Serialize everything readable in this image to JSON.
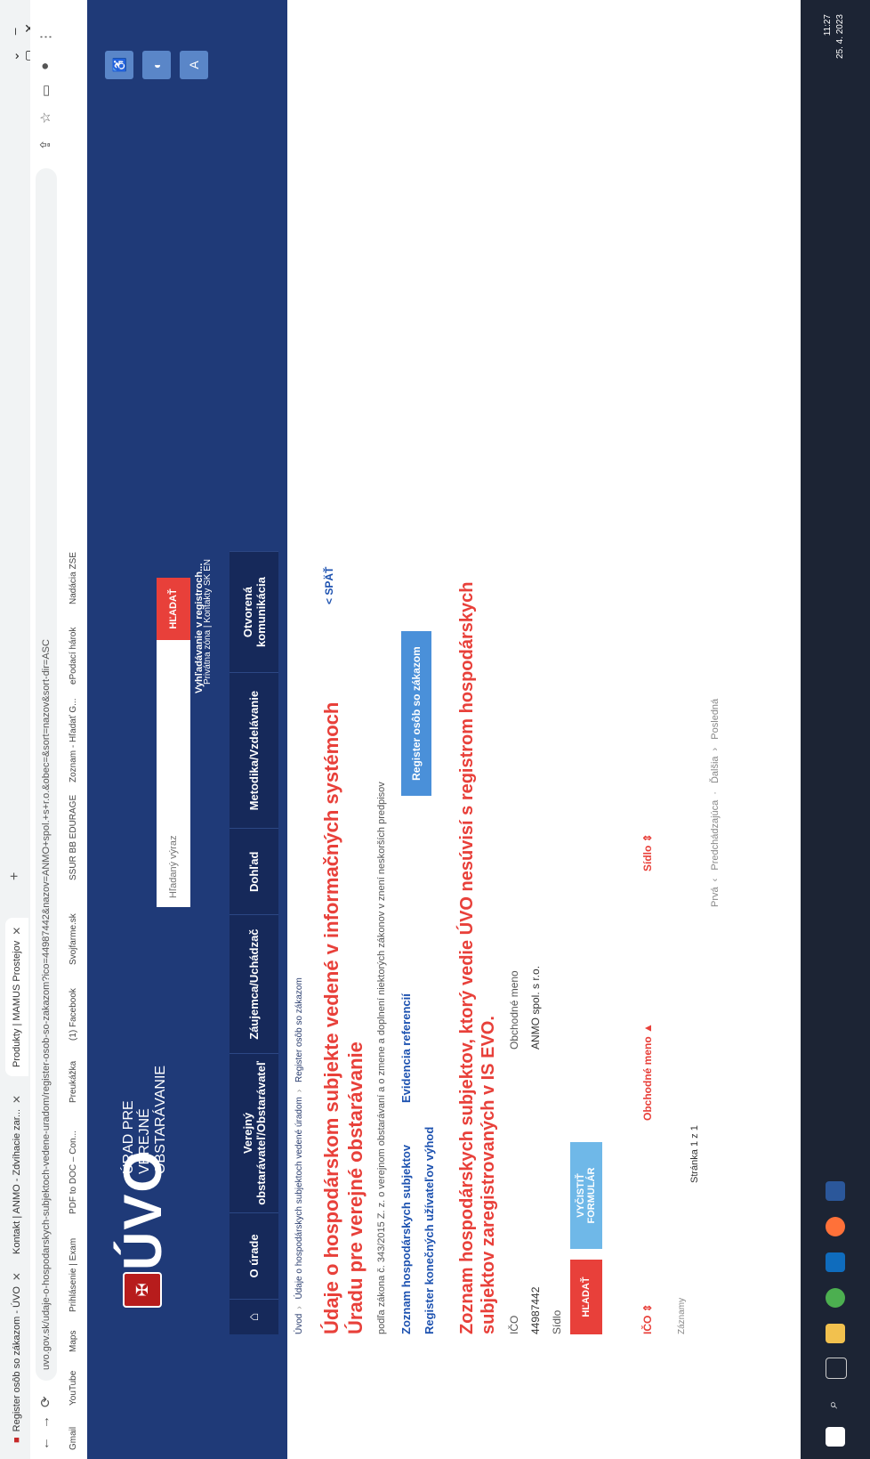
{
  "browser": {
    "tabs": [
      {
        "label": "Register osôb so zákazom - ÚVO"
      },
      {
        "label": "Kontakt | ANMO - Zdvíhacie zar..."
      },
      {
        "label": "Produkty | MAMUS Prostejov"
      }
    ],
    "url": "uvo.gov.sk/udaje-o-hospodarskych-subjektoch-vedene-uradom/register-osob-so-zakazom?ico=44987442&nazov=ANMO+spol.+s+r.o.&obec=&sort=nazov&sort-dir=ASC",
    "bookmarks": [
      "Gmail",
      "YouTube",
      "Maps",
      "Prihlásenie | Exam",
      "PDF to DOC – Con...",
      "Preukážka",
      "(1) Facebook",
      "Svojfarme.sk",
      "SSUR BB EDURAGE",
      "Zoznam - Hľadať G...",
      "ePodací hárok",
      "Nadácia ZSE"
    ]
  },
  "header": {
    "logo_text": "ÚVO",
    "logo_subtitle": "ÚRAD PRE VEREJNÉ OBSTARÁVANIE",
    "util_links": "Privátna zóna  |  Kontakty  SK  EN",
    "search_placeholder": "Hľadaný výraz",
    "search_button": "HĽADAŤ",
    "advanced_search": "Vyhľadávanie v registroch...",
    "nav": [
      "⌂",
      "O úrade",
      "Verejný obstarávateľ/Obstarávateľ",
      "Záujemca/Uchádzač",
      "Dohľad",
      "Metodika/Vzdelávanie",
      "Otvorená komunikácia"
    ]
  },
  "content": {
    "breadcrumb": [
      "Úvod",
      "Údaje o hospodárskych subjektoch vedené úradom",
      "Register osôb so zákazom"
    ],
    "title": "Údaje o hospodárskom subjekte vedené v informačných systémoch Úradu pre verejné obstarávanie",
    "back": "< SPÄŤ",
    "law_text": "podľa zákona č. 343/2015 Z. z. o verejnom obstarávaní a o zmene a doplnení niektorých zákonov v znení neskorších predpisov",
    "links": [
      "Zoznam hospodárskych subjektov",
      "Evidencia referencií",
      "Register konečných užívateľov výhod"
    ],
    "register_button": "Register osôb so zákazom",
    "list_title": "Zoznam hospodárskych subjektov, ktorý vedie ÚVO nesúvisí s registrom hospodárskych subjektov zaregistrovaných v IS EVO.",
    "fields": {
      "ico_label": "IČO",
      "ico_value": "44987442",
      "name_label": "Obchodné meno",
      "name_value": "ANMO spol. s r.o.",
      "seat_label": "Sídlo"
    },
    "search_btn": "HĽADAŤ",
    "clear_btn": "VYČISTIŤ FORMULÁR",
    "columns": [
      "IČO  ⇕",
      "Obchodné meno  ▲",
      "Sídlo  ⇕"
    ],
    "no_records": "Záznamy",
    "pager_label": "Stránka  1  z  1",
    "pager": [
      "Prvá",
      "Predchádzajúca",
      "Ďalšia",
      "Posledná"
    ]
  },
  "taskbar": {
    "time": "11:27",
    "date": "25. 4. 2023"
  }
}
